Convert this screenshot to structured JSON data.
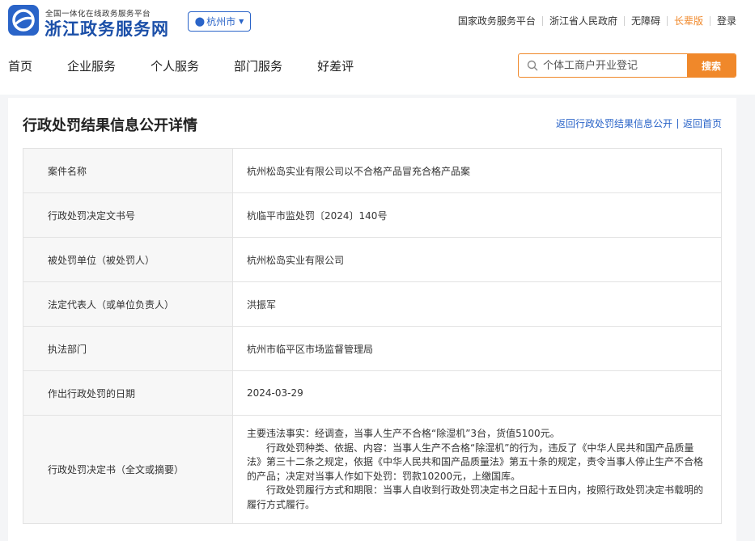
{
  "header": {
    "logo_tagline": "全国一体化在线政务服务平台",
    "logo_title": "浙江政务服务网",
    "city": "杭州市",
    "top_links": [
      "国家政务服务平台",
      "浙江省人民政府",
      "无障碍",
      "长辈版",
      "登录"
    ],
    "accent_color": "#f0882a",
    "brand_color": "#2a64c8"
  },
  "nav": {
    "items": [
      "首页",
      "企业服务",
      "个人服务",
      "部门服务",
      "好差评"
    ]
  },
  "search": {
    "placeholder": "个体工商户开业登记",
    "button_label": "搜索"
  },
  "page": {
    "title": "行政处罚结果信息公开详情",
    "links": [
      "返回行政处罚结果信息公开",
      "返回首页"
    ]
  },
  "details": {
    "rows": [
      {
        "label": "案件名称",
        "value": "杭州松岛实业有限公司以不合格产品冒充合格产品案"
      },
      {
        "label": "行政处罚决定文书号",
        "value": "杭临平市监处罚〔2024〕140号"
      },
      {
        "label": "被处罚单位（被处罚人）",
        "value": "杭州松岛实业有限公司"
      },
      {
        "label": "法定代表人（或单位负责人）",
        "value": "洪振军"
      },
      {
        "label": "执法部门",
        "value": "杭州市临平区市场监督管理局"
      },
      {
        "label": "作出行政处罚的日期",
        "value": "2024-03-29"
      }
    ],
    "decision": {
      "label": "行政处罚决定书（全文或摘要）",
      "paragraphs": [
        "主要违法事实：经调查，当事人生产不合格“除湿机”3台，货值5100元。",
        "行政处罚种类、依据、内容：当事人生产不合格“除湿机”的行为，违反了《中华人民共和国产品质量法》第三十二条之规定，依据《中华人民共和国产品质量法》第五十条的规定，责令当事人停止生产不合格的产品；决定对当事人作如下处罚：罚款10200元，上缴国库。",
        "行政处罚履行方式和期限：当事人自收到行政处罚决定书之日起十五日内，按照行政处罚决定书载明的履行方式履行。"
      ]
    }
  }
}
